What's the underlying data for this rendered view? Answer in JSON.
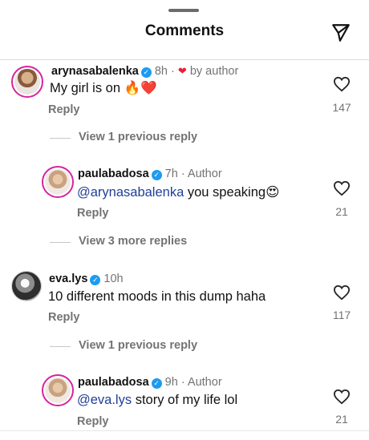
{
  "header": {
    "title": "Comments",
    "send_icon": "paper-plane-icon"
  },
  "comments": [
    {
      "username": "arynasabalenka",
      "time": "8h",
      "liked_by_author_label": "by author",
      "text": "My girl is on",
      "emojis": "🔥❤️",
      "reply_label": "Reply",
      "likes": "147"
    },
    {
      "username": "paulabadosa",
      "time": "7h",
      "author_label": "Author",
      "mention": "@arynasabalenka",
      "text": "you speaking",
      "emojis": "😍",
      "reply_label": "Reply",
      "likes": "21"
    },
    {
      "username": "eva.lys",
      "time": "10h",
      "text": "10 different moods in this dump haha",
      "reply_label": "Reply",
      "likes": "117"
    },
    {
      "username": "paulabadosa",
      "time": "9h",
      "author_label": "Author",
      "mention": "@eva.lys",
      "text": "story of my life lol",
      "reply_label": "Reply",
      "likes": "21"
    }
  ],
  "view_replies": [
    {
      "label": "View 1 previous reply"
    },
    {
      "label": "View 3 more replies"
    },
    {
      "label": "View 1 previous reply"
    }
  ],
  "colors": {
    "accent_heart": "#ed1d3a",
    "mention": "#1f3f99",
    "verified": "#1d9bf0",
    "muted": "#737373"
  }
}
